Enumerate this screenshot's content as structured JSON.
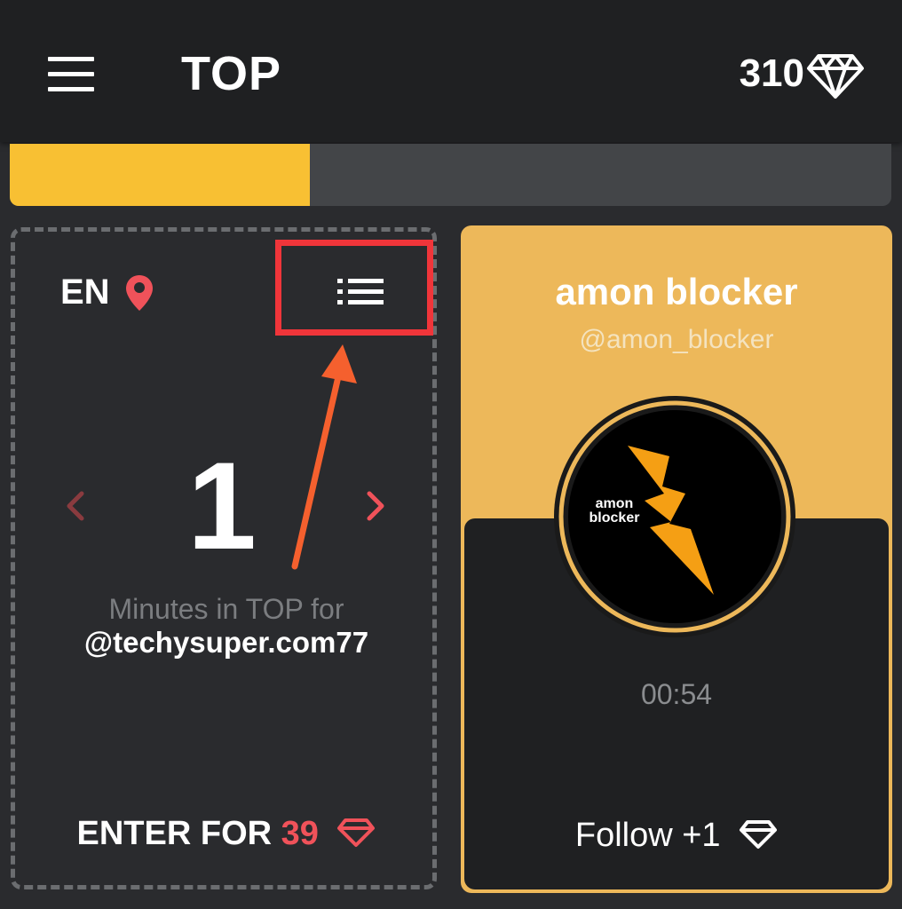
{
  "header": {
    "title": "TOP",
    "balance": "310",
    "menu_icon": "hamburger-menu-icon",
    "currency_icon": "diamond-icon"
  },
  "progress": {
    "fraction": 0.34,
    "fill_color": "#f8c033",
    "track_color": "#434548"
  },
  "left_card": {
    "language": "EN",
    "location_icon": "map-pin-icon",
    "list_icon": "list-icon",
    "rank": "1",
    "minutes_label": "Minutes in TOP for",
    "username": "@techysuper.com77",
    "enter_label": "ENTER FOR",
    "enter_cost": "39",
    "highlight_color": "#f0353a"
  },
  "right_card": {
    "name": "amon  blocker",
    "handle": "@amon_blocker",
    "avatar_text": "amon blocker",
    "timer": "00:54",
    "follow_label": "Follow +1",
    "accent_color": "#edb85a"
  }
}
